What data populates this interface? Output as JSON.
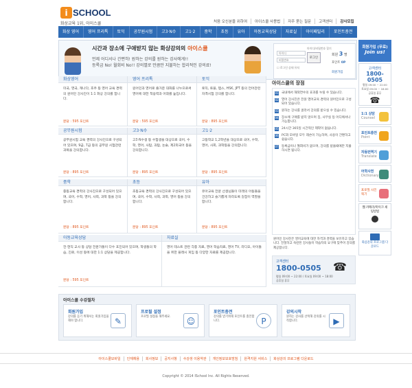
{
  "logo": {
    "mark": "i",
    "text": "SCHOOL"
  },
  "slogan": "화상교육 1위, 아이스쿨",
  "topnav": [
    "처음 오신분을 위하여",
    "아이스쿨 사용법",
    "자주 묻는 질문",
    "고객센터"
  ],
  "topnav_highlight": "강사모집",
  "gnb": [
    "화상 영어",
    "영어 프리톡",
    "토익",
    "공무원시험",
    "고3·N수",
    "고1·2",
    "중학",
    "초등",
    "유아",
    "아동교육상담",
    "자료실",
    "아이패밀리",
    "포인트충전"
  ],
  "banner": {
    "headline_pre": "시간과 장소에 구애받지 않는 화상강의의",
    "headline_brand": "아이스쿨",
    "line2": "언제 어디서나 간편히! 원하는 강의를 원하는 강사에게!!",
    "line3": "등록금 No! 월회비 No!! 강의별로 만큼만 지불하는 합리적인 강의료!"
  },
  "login": {
    "id_placeholder": "아이디",
    "pw_placeholder": "비밀번호",
    "hint": "아이디/비밀번호 찾기",
    "login_btn": "로그인",
    "autologin": "로그인 상태 유지",
    "users_label": "회원",
    "users_count": "3",
    "users_unit": "명",
    "points_label": "포인트",
    "points_value": "0P",
    "join_label": "회원가입"
  },
  "courses": [
    {
      "title": "화상영어",
      "desc": "미국, 영국, 캐나다, 호주 등 영어 교육 경력의 원어민 강사진이 1:1 화상 강의를 합니다.",
      "price": "분당 : 595 포인트"
    },
    {
      "title": "영어 프리톡",
      "desc": "원어민과 영어로 즐거운 대화를 나누으로써 영어에 대한 적응력과 어휘를 높입니다.",
      "price": "분당 : 595 포인트"
    },
    {
      "title": "토익",
      "desc": "토익, 토플, 텝스, HSK, JPT 등의 언어관련 자격시험 강의를 합니다.",
      "price": "분당 : 895 포인트"
    },
    {
      "title": "공무원시험",
      "desc": "공무원시험 교육 경력의 강사진으로 구성되어 있으며, 9급, 7급 등의 공무원 시험관련 과목을 강의합니다.",
      "price": "분당 : 895 포인트"
    },
    {
      "title": "고3·N수",
      "desc": "고3·N수생 등 수험생을 대상으로 국어, 수학, 영어, 사탐, 과탐, 논술, 제2외국어 등을 강의합니다.",
      "price": "분당 : 895 포인트"
    },
    {
      "title": "고1·2",
      "desc": "고등학교 1,2학년을 대상으로 국어, 수학, 영어, 사회, 과학등을 강의합니다.",
      "price": "분당 : 895 포인트"
    },
    {
      "title": "중학",
      "desc": "중등교육 경력의 강사진으로 구성되어 있으며, 국어, 수학, 영어, 사회, 과학 등을 강의합니다.",
      "price": "분당 : 895 포인트"
    },
    {
      "title": "초등",
      "desc": "초등교육 경력의 강사진으로 구성되어 있으며, 국어, 수학, 사회, 과학, 영어 등을 강의합니다.",
      "price": "분당 : 895 포인트"
    },
    {
      "title": "유아",
      "desc": "유아교육 전문 선생님들이 미래의 아동들을 건강하고 슬기롭게 자라도록 길잡이 역할을 합니다.",
      "price": "분당 : 895 포인트"
    },
    {
      "title": "아동교육상담",
      "desc": "전·현직 교사 등 상담 전문가들이 다수 포진되어 있으며, 학생들의 학습, 진로, 이성 등에 대한 1:1 상담을 제공합니다.",
      "price": "분당 : 595 포인트"
    },
    {
      "title": "자료실",
      "desc": "영어 테스트 관련 각종 자료, 영어 학습자료, 영어 TV, 라디오, 아이들을 위한 플래시 게임 등 다양한 자료를 제공합니다.",
      "price": ""
    }
  ],
  "merits": {
    "title": "아이스쿨의 장점",
    "items": [
      "국내에서 해외연수의 효과를 누릴 수 있습니다.",
      "영어 강사진은 전원 영어교육 경력의 원어민으로 구성되어 있습니다.",
      "원하는 강사를 골라서 강의를 받으실 수 있습니다.",
      "장소에 구애를 받지 않으며 집, 사무실 등 어디에서나 가능합니다.",
      "24시간 365일 시간적인 제약이 없습니다.",
      "PC와 모바일 모두 레슨이 가능하며, 사용이 간편하고 쉽습니다.",
      "등록금이나 월회비가 없으며, 강의를 받을때에만 지불하시면 됩니다."
    ],
    "desc": "원어민 강사진은 영어교육에 대한 자격과 경력을 보유하고 있습니다. 친절하고 숙련된 강사들이 학습자의 요구에 맞추어 강의를 제공합니다."
  },
  "callcenter": {
    "label": "고객센터",
    "number": "1800-0505",
    "hours1": "평일 09:00 ~ 22:00 / 토요일 09:00 ~ 18:00",
    "hours2": "공휴일 휴무"
  },
  "quick": {
    "join": "회원가입 (무료)",
    "join_sub": "Join us!",
    "cc_label": "고객센터",
    "cc_number": "1800-0505",
    "cc_h1": "평일 09:00 ~ 22:00",
    "cc_h2": "토요일 09:00 ~ 18:00",
    "cc_h3": "공휴일 휴무",
    "counsel": "1:1 상담",
    "counsel_en": "Counsel",
    "point": "포인트충전",
    "point_en": "Point",
    "translate": "자동번역기",
    "translate_en": "Translate",
    "dict": "어학사전",
    "dict_en": "Dictionary",
    "photo": "프로필 사진찍기",
    "webcam": "웹 카메라/마이크 세팅방법",
    "program": "화상강의 프로그램 다운로드"
  },
  "process": {
    "title": "아이스쿨 수강절차",
    "steps": [
      {
        "t": "회원가입",
        "d": "강의를 듣기 위해서는 회원가입을 해야 합니다.",
        "i": "✎"
      },
      {
        "t": "프로필 설정",
        "d": "프로필 설정을 해주세요.",
        "i": "☺"
      },
      {
        "t": "포인트충전",
        "d": "강의를 받기위해 포인트를 충전합니다.",
        "i": "P"
      },
      {
        "t": "강의시작",
        "d": "원하는 강사를 선택해 강의를 시작합니다.",
        "i": "▶"
      }
    ]
  },
  "footer": [
    "아이스쿨모바일",
    "인재채용",
    "회사정보",
    "공지사항",
    "수강생 이용약관",
    "개인정보보호방침",
    "원격지원 서비스",
    "화상강의 프로그램 다운로드"
  ],
  "copyright": "Copyright © 2014 ISchool Inc. All Rights Reserved."
}
